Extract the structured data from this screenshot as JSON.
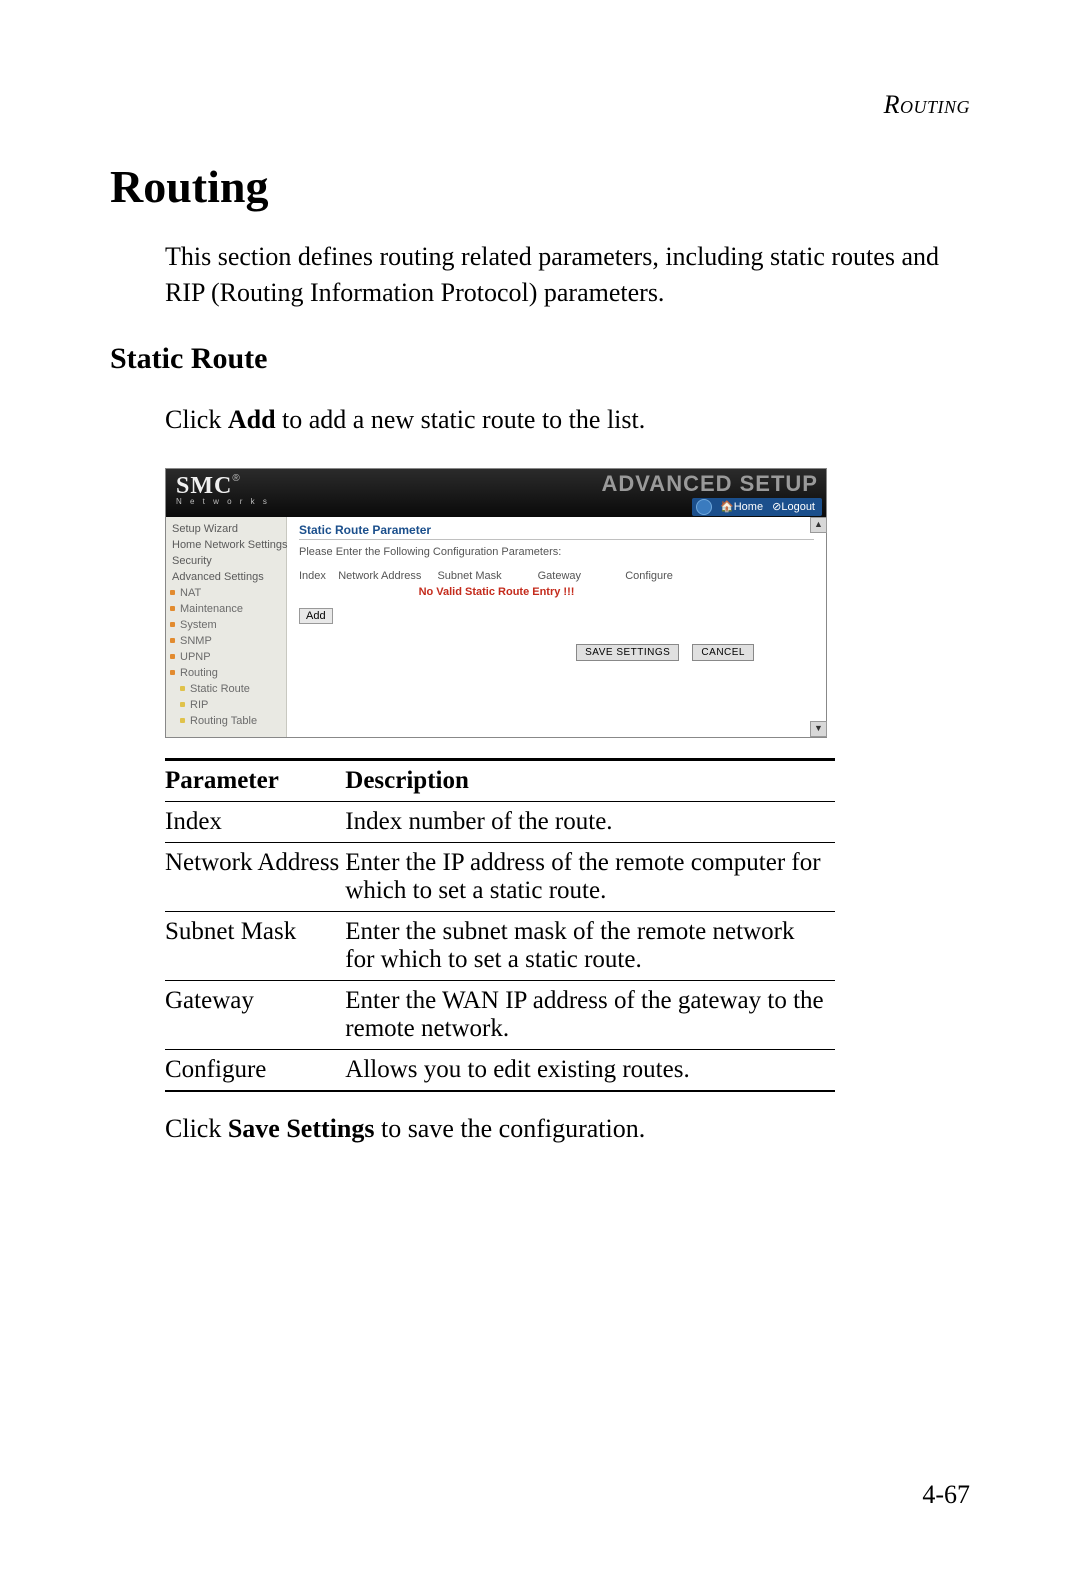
{
  "running_head": "Routing",
  "section_title": "Routing",
  "intro_text": "This section defines routing related parameters, including static routes and RIP (Routing Information Protocol) parameters.",
  "subsection_title": "Static Route",
  "sub_intro_pre": "Click ",
  "sub_intro_bold": "Add",
  "sub_intro_post": " to add a new static route to the list.",
  "screenshot": {
    "logo_main": "SMC",
    "logo_reg": "®",
    "logo_sub": "N e t w o r k s",
    "banner_title": "ADVANCED SETUP",
    "home_link": "Home",
    "logout_link": "Logout",
    "sidebar": {
      "i0": "Setup Wizard",
      "i1": "Home Network Settings",
      "i2": "Security",
      "i3": "Advanced Settings",
      "s0": "NAT",
      "s1": "Maintenance",
      "s2": "System",
      "s3": "SNMP",
      "s4": "UPNP",
      "s5": "Routing",
      "ss0": "Static Route",
      "ss1": "RIP",
      "ss2": "Routing Table"
    },
    "content": {
      "title": "Static Route Parameter",
      "instruction": "Please Enter the Following Configuration Parameters:",
      "col0": "Index",
      "col1": "Network Address",
      "col2": "Subnet Mask",
      "col3": "Gateway",
      "col4": "Configure",
      "no_valid": "No Valid Static Route Entry !!!",
      "add_btn": "Add",
      "save_btn": "SAVE SETTINGS",
      "cancel_btn": "CANCEL"
    }
  },
  "param_table": {
    "h0": "Parameter",
    "h1": "Description",
    "rows": [
      {
        "p": "Index",
        "d": "Index number of the route."
      },
      {
        "p": "Network Address",
        "d": "Enter the IP address of the remote computer for which to set a static route."
      },
      {
        "p": "Subnet Mask",
        "d": "Enter the subnet mask of the remote network for which to set a static route."
      },
      {
        "p": "Gateway",
        "d": "Enter the WAN IP address of the gateway to the remote network."
      },
      {
        "p": "Configure",
        "d": "Allows you to edit existing routes."
      }
    ]
  },
  "closing_pre": "Click ",
  "closing_bold": "Save Settings",
  "closing_post": " to save the configuration.",
  "page_number": "4-67"
}
